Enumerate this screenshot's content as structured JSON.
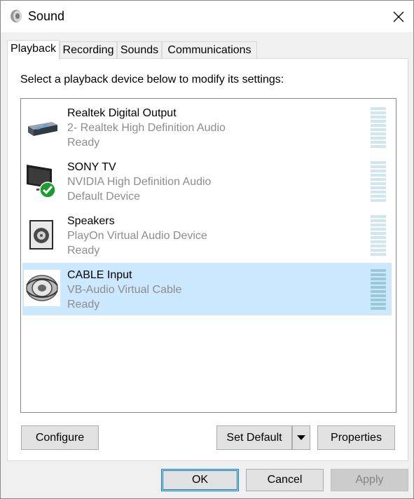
{
  "window": {
    "title": "Sound",
    "title_icon": "speaker-icon",
    "close_icon": "close-icon"
  },
  "tabs": [
    {
      "label": "Playback",
      "active": true
    },
    {
      "label": "Recording",
      "active": false
    },
    {
      "label": "Sounds",
      "active": false
    },
    {
      "label": "Communications",
      "active": false
    }
  ],
  "panel": {
    "instructions": "Select a playback device below to modify its settings:",
    "devices": [
      {
        "name": "Realtek Digital Output",
        "description": "2- Realtek High Definition Audio",
        "status": "Ready",
        "icon": "digital-output-icon",
        "selected": false
      },
      {
        "name": "SONY TV",
        "description": "NVIDIA High Definition Audio",
        "status": "Default Device",
        "icon": "tv-icon",
        "badge": "default-check-icon",
        "selected": false
      },
      {
        "name": "Speakers",
        "description": "PlayOn Virtual Audio Device",
        "status": "Ready",
        "icon": "speaker-box-icon",
        "selected": false
      },
      {
        "name": "CABLE Input",
        "description": "VB-Audio Virtual Cable",
        "status": "Ready",
        "icon": "cable-icon",
        "selected": true
      }
    ],
    "buttons": {
      "configure": "Configure",
      "set_default": "Set Default",
      "properties": "Properties"
    }
  },
  "footer": {
    "ok": "OK",
    "cancel": "Cancel",
    "apply": "Apply"
  },
  "colors": {
    "selection": "#cce8ff",
    "accent": "#0078d7",
    "check": "#1e9b2e"
  }
}
